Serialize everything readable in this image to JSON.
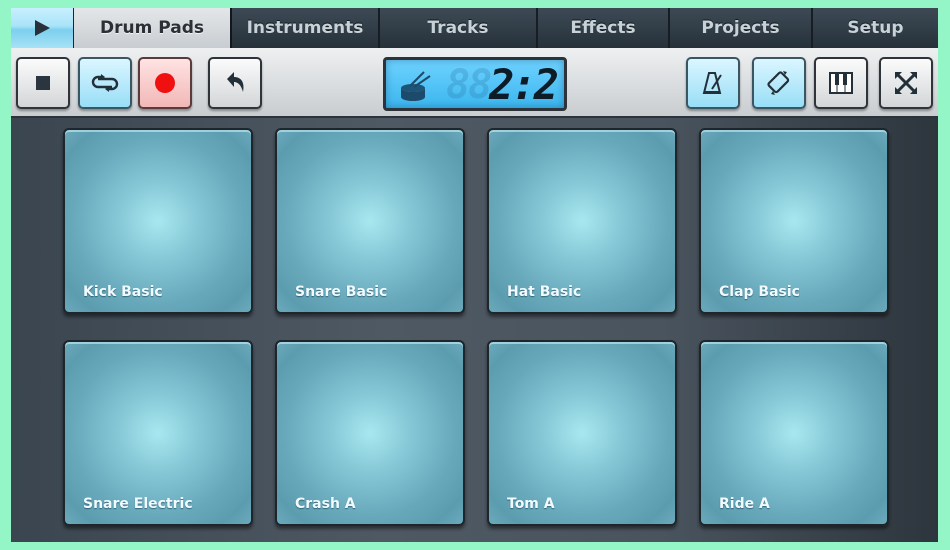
{
  "tabs": {
    "play_icon": "play-icon",
    "items": [
      {
        "label": "Drum Pads",
        "active": true
      },
      {
        "label": "Instruments",
        "active": false
      },
      {
        "label": "Tracks",
        "active": false
      },
      {
        "label": "Effects",
        "active": false
      },
      {
        "label": "Projects",
        "active": false
      },
      {
        "label": "Setup",
        "active": false
      }
    ]
  },
  "toolbar": {
    "left_buttons": [
      {
        "name": "stop",
        "icon": "stop-icon",
        "active": false
      },
      {
        "name": "loop",
        "icon": "loop-icon",
        "active": true
      },
      {
        "name": "record",
        "icon": "record-icon",
        "active": true
      },
      {
        "name": "undo",
        "icon": "undo-icon",
        "active": false
      }
    ],
    "right_buttons": [
      {
        "name": "metronome",
        "icon": "metronome-icon",
        "active": true
      },
      {
        "name": "rotate",
        "icon": "rotate-icon",
        "active": true
      },
      {
        "name": "piano",
        "icon": "piano-keys-icon",
        "active": false
      },
      {
        "name": "fullscreen",
        "icon": "expand-icon",
        "active": false
      }
    ],
    "display": {
      "icon": "drum-icon",
      "ghost_digits": "88",
      "position": "2:2"
    }
  },
  "colors": {
    "accent_blue": "#98def7",
    "record_red": "#f01010",
    "pad_center": "#a7e8f0",
    "pad_edge": "#5c9caf",
    "frame": "#94f5c6"
  },
  "pads": [
    {
      "label": "Kick Basic"
    },
    {
      "label": "Snare Basic"
    },
    {
      "label": "Hat Basic"
    },
    {
      "label": "Clap Basic"
    },
    {
      "label": "Snare Electric"
    },
    {
      "label": "Crash A"
    },
    {
      "label": "Tom A"
    },
    {
      "label": "Ride A"
    }
  ]
}
